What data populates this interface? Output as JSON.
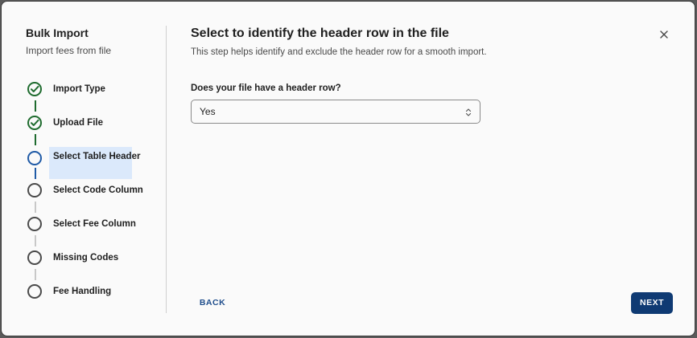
{
  "sidebar": {
    "title": "Bulk Import",
    "subtitle": "Import fees from file",
    "steps": [
      {
        "label": "Import Type",
        "status": "complete"
      },
      {
        "label": "Upload File",
        "status": "complete"
      },
      {
        "label": "Select Table Header",
        "status": "active"
      },
      {
        "label": "Select Code Column",
        "status": "pending"
      },
      {
        "label": "Select Fee Column",
        "status": "pending"
      },
      {
        "label": "Missing Codes",
        "status": "pending"
      },
      {
        "label": "Fee Handling",
        "status": "pending"
      }
    ]
  },
  "main": {
    "title": "Select to identify the header row in the file",
    "description": "This step helps identify and exclude the header row for a smooth import.",
    "question": "Does your file have a header row?",
    "select_value": "Yes"
  },
  "footer": {
    "back_label": "BACK",
    "next_label": "NEXT"
  },
  "icons": {
    "close": "close-icon",
    "check": "check-icon",
    "select": "chevron-up-down-icon"
  },
  "colors": {
    "complete": "#1e6b2e",
    "active": "#1f5aa6",
    "active_bg": "#dbe9fb",
    "primary_button": "#0f3a73",
    "link": "#1f4e8c"
  }
}
